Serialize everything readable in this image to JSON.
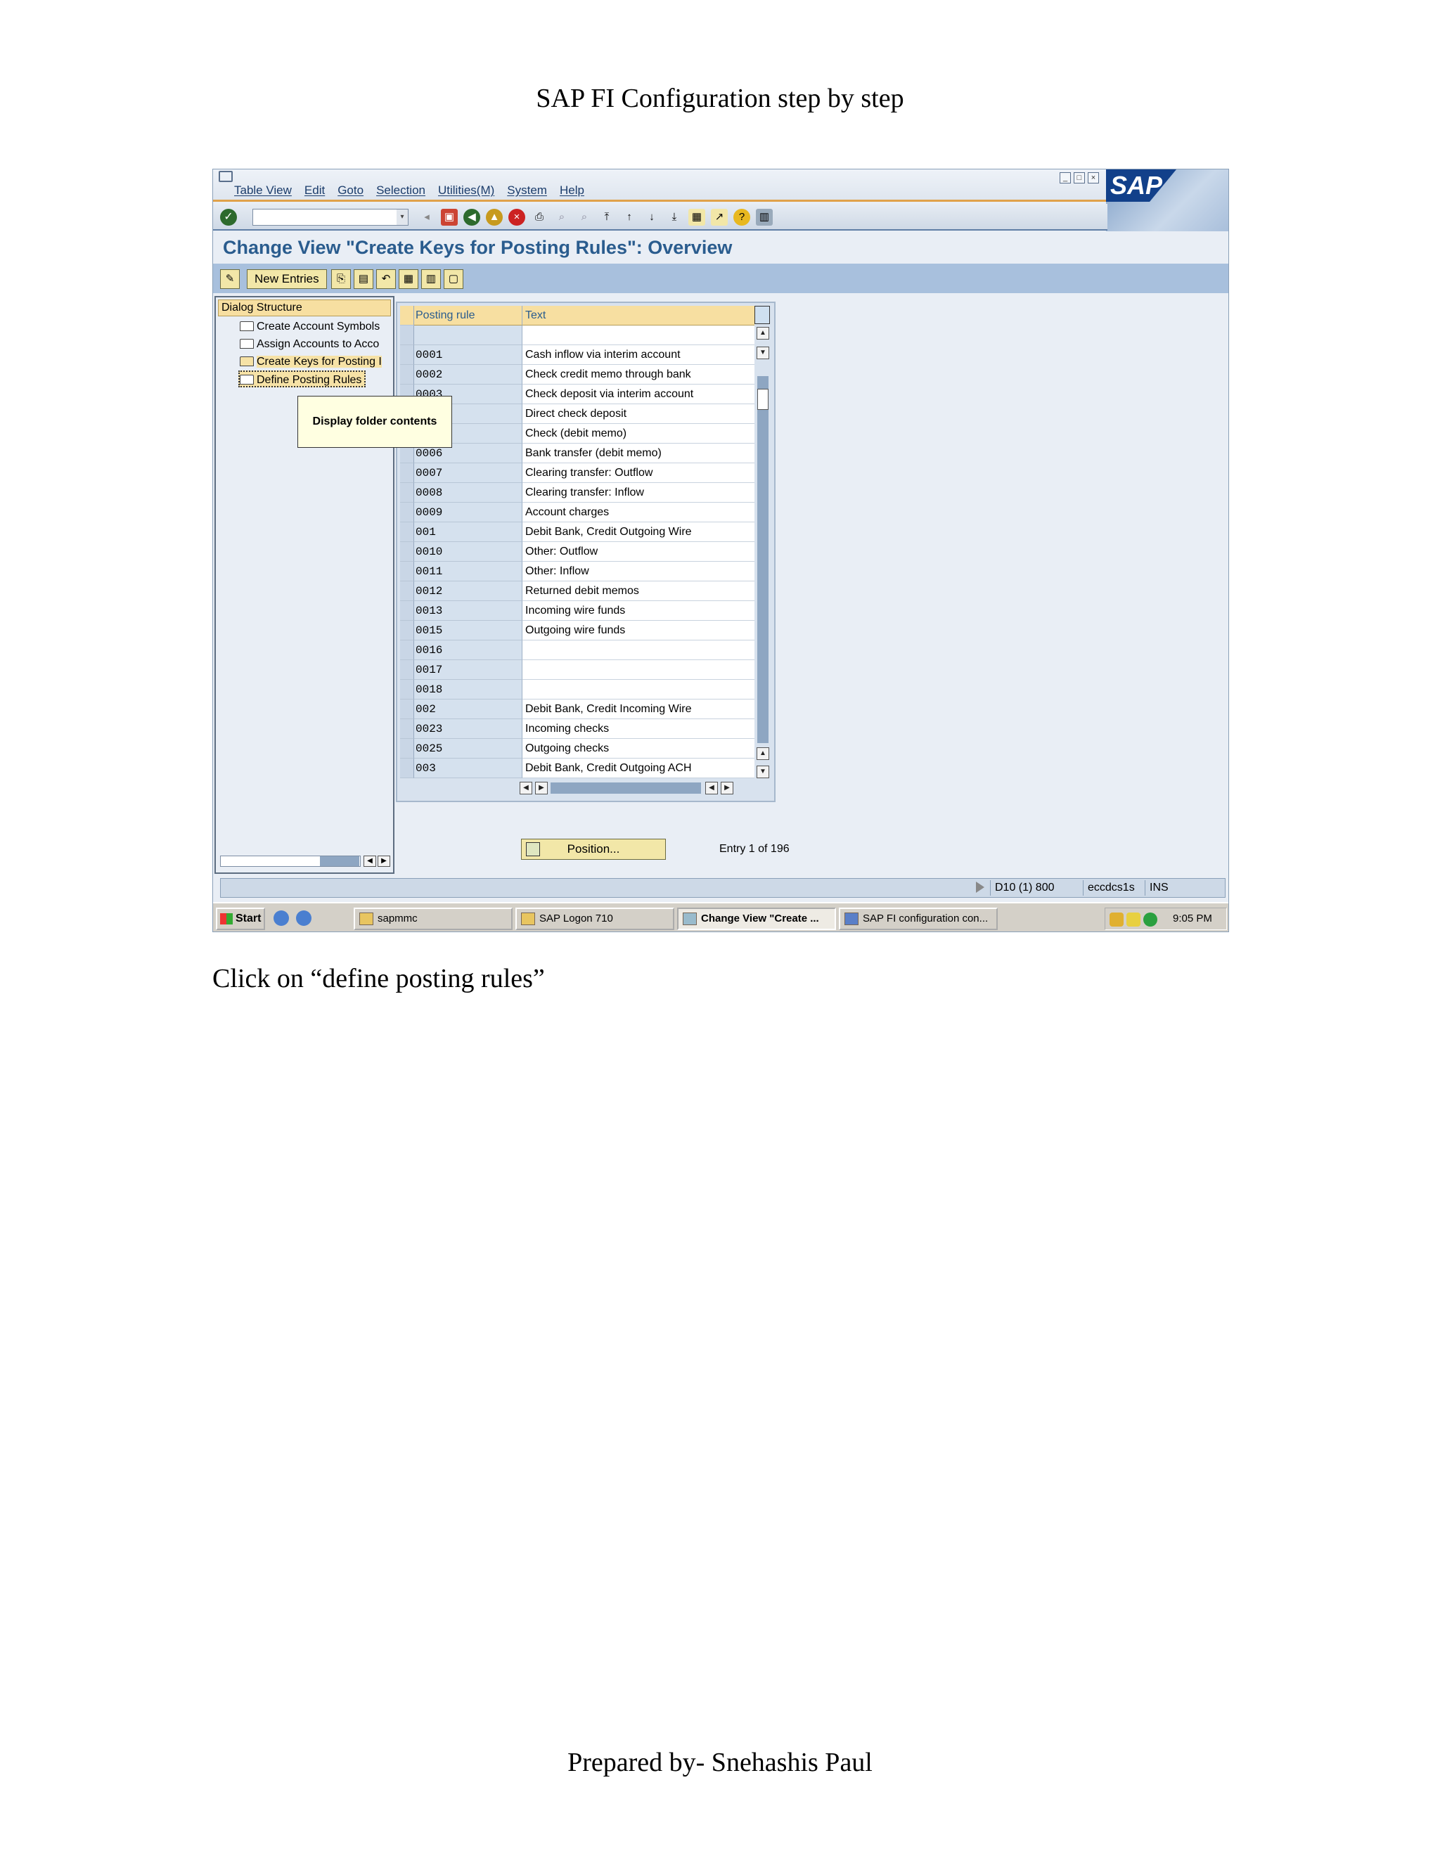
{
  "document": {
    "title": "SAP FI Configuration step by step",
    "caption": "Click on “define posting rules”",
    "footer": "Prepared by- Snehashis Paul"
  },
  "sap": {
    "menu": [
      "Table View",
      "Edit",
      "Goto",
      "Selection",
      "Utilities(M)",
      "System",
      "Help"
    ],
    "logo": "SAP",
    "screen_title": "Change View \"Create Keys for Posting Rules\": Overview",
    "app_toolbar": {
      "new_entries": "New Entries"
    },
    "dialog_structure": {
      "header": "Dialog Structure",
      "items": [
        "Create Account Symbols",
        "Assign Accounts to Acco",
        "Create Keys for Posting I",
        "Define Posting Rules"
      ]
    },
    "tooltip": "Display folder contents",
    "table": {
      "columns": [
        "Posting rule",
        "Text"
      ],
      "rows": [
        [
          "",
          ""
        ],
        [
          "0001",
          "Cash inflow via interim account"
        ],
        [
          "0002",
          "Check credit memo through bank"
        ],
        [
          "0003",
          "Check deposit via interim account"
        ],
        [
          "",
          "Direct check deposit"
        ],
        [
          "",
          "Check (debit memo)"
        ],
        [
          "0006",
          "Bank transfer (debit memo)"
        ],
        [
          "0007",
          "Clearing transfer: Outflow"
        ],
        [
          "0008",
          "Clearing transfer: Inflow"
        ],
        [
          "0009",
          "Account charges"
        ],
        [
          "001",
          "Debit Bank, Credit Outgoing Wire"
        ],
        [
          "0010",
          "Other: Outflow"
        ],
        [
          "0011",
          "Other: Inflow"
        ],
        [
          "0012",
          "Returned debit memos"
        ],
        [
          "0013",
          "Incoming wire funds"
        ],
        [
          "0015",
          "Outgoing wire funds"
        ],
        [
          "0016",
          ""
        ],
        [
          "0017",
          ""
        ],
        [
          "0018",
          ""
        ],
        [
          "002",
          "Debit Bank, Credit Incoming Wire"
        ],
        [
          "0023",
          "Incoming checks"
        ],
        [
          "0025",
          "Outgoing checks"
        ],
        [
          "003",
          "Debit Bank, Credit Outgoing ACH"
        ]
      ]
    },
    "position_button": "Position...",
    "entry_info": "Entry 1 of 196",
    "status": {
      "system": "D10 (1) 800",
      "server": "eccdcs1s",
      "mode": "INS"
    }
  },
  "taskbar": {
    "start": "Start",
    "tasks": [
      "sapmmc",
      "SAP Logon 710",
      "Change View \"Create ...",
      "SAP FI configuration con..."
    ],
    "clock": "9:05 PM"
  }
}
